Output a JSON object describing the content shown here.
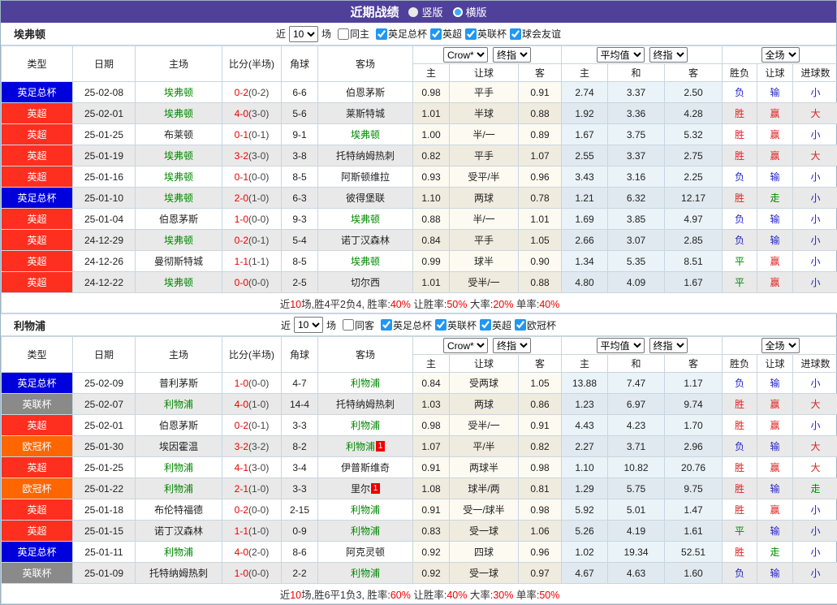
{
  "title": "近期战绩",
  "view_modes": {
    "vertical": "竖版",
    "horizontal": "横版"
  },
  "league_colors": {
    "英足总杯": "#0000dd",
    "英超": "#ff2f1f",
    "英联杯": "#8a8a8a",
    "欧冠杯": "#ff6600",
    "球会友谊": "#8a8a8a"
  },
  "result_colors": {
    "胜": "#dd2222",
    "赢": "#dd2222",
    "大": "#dd2222",
    "负": "#2222cc",
    "输": "#2222cc",
    "小": "#2222cc",
    "平": "#008800",
    "走": "#008800"
  },
  "columns": {
    "type": "类型",
    "date": "日期",
    "home": "主场",
    "score": "比分(半场)",
    "corner": "角球",
    "away": "客场",
    "h": "主",
    "handicap": "让球",
    "a": "客",
    "avg_h": "主",
    "avg_d": "和",
    "avg_a": "客",
    "wdl": "胜负",
    "asian": "让球",
    "goals": "进球数"
  },
  "selectors": {
    "bookmaker": "Crow*",
    "final1": "终指",
    "average": "平均值",
    "final2": "终指",
    "scope": "全场"
  },
  "filter_labels": {
    "recent": "近",
    "matches": "场",
    "count": "10"
  },
  "sections": [
    {
      "team": "埃弗顿",
      "same_venue_label": "同主",
      "leagues": [
        "英足总杯",
        "英超",
        "英联杯",
        "球会友谊"
      ],
      "rows": [
        {
          "lg": "英足总杯",
          "date": "25-02-08",
          "home": "埃弗顿",
          "home_self": true,
          "ft": "0-2",
          "ht": "0-2",
          "corner": "6-6",
          "away": "伯恩茅斯",
          "away_self": false,
          "away_cards": 0,
          "bk": [
            "0.98",
            "平手",
            "0.91"
          ],
          "avg": [
            "2.74",
            "3.37",
            "2.50"
          ],
          "res": [
            "负",
            "输",
            "小"
          ]
        },
        {
          "lg": "英超",
          "date": "25-02-01",
          "home": "埃弗顿",
          "home_self": true,
          "ft": "4-0",
          "ht": "3-0",
          "corner": "5-6",
          "away": "莱斯特城",
          "away_self": false,
          "away_cards": 0,
          "bk": [
            "1.01",
            "半球",
            "0.88"
          ],
          "avg": [
            "1.92",
            "3.36",
            "4.28"
          ],
          "res": [
            "胜",
            "赢",
            "大"
          ]
        },
        {
          "lg": "英超",
          "date": "25-01-25",
          "home": "布莱顿",
          "home_self": false,
          "ft": "0-1",
          "ht": "0-1",
          "corner": "9-1",
          "away": "埃弗顿",
          "away_self": true,
          "away_cards": 0,
          "bk": [
            "1.00",
            "半/一",
            "0.89"
          ],
          "avg": [
            "1.67",
            "3.75",
            "5.32"
          ],
          "res": [
            "胜",
            "赢",
            "小"
          ]
        },
        {
          "lg": "英超",
          "date": "25-01-19",
          "home": "埃弗顿",
          "home_self": true,
          "ft": "3-2",
          "ht": "3-0",
          "corner": "3-8",
          "away": "托特纳姆热刺",
          "away_self": false,
          "away_cards": 0,
          "bk": [
            "0.82",
            "平手",
            "1.07"
          ],
          "avg": [
            "2.55",
            "3.37",
            "2.75"
          ],
          "res": [
            "胜",
            "赢",
            "大"
          ]
        },
        {
          "lg": "英超",
          "date": "25-01-16",
          "home": "埃弗顿",
          "home_self": true,
          "ft": "0-1",
          "ht": "0-0",
          "corner": "8-5",
          "away": "阿斯顿维拉",
          "away_self": false,
          "away_cards": 0,
          "bk": [
            "0.93",
            "受平/半",
            "0.96"
          ],
          "avg": [
            "3.43",
            "3.16",
            "2.25"
          ],
          "res": [
            "负",
            "输",
            "小"
          ]
        },
        {
          "lg": "英足总杯",
          "date": "25-01-10",
          "home": "埃弗顿",
          "home_self": true,
          "ft": "2-0",
          "ht": "1-0",
          "corner": "6-3",
          "away": "彼得堡联",
          "away_self": false,
          "away_cards": 0,
          "bk": [
            "1.10",
            "两球",
            "0.78"
          ],
          "avg": [
            "1.21",
            "6.32",
            "12.17"
          ],
          "res": [
            "胜",
            "走",
            "小"
          ]
        },
        {
          "lg": "英超",
          "date": "25-01-04",
          "home": "伯恩茅斯",
          "home_self": false,
          "ft": "1-0",
          "ht": "0-0",
          "corner": "9-3",
          "away": "埃弗顿",
          "away_self": true,
          "away_cards": 0,
          "bk": [
            "0.88",
            "半/一",
            "1.01"
          ],
          "avg": [
            "1.69",
            "3.85",
            "4.97"
          ],
          "res": [
            "负",
            "输",
            "小"
          ]
        },
        {
          "lg": "英超",
          "date": "24-12-29",
          "home": "埃弗顿",
          "home_self": true,
          "ft": "0-2",
          "ht": "0-1",
          "corner": "5-4",
          "away": "诺丁汉森林",
          "away_self": false,
          "away_cards": 0,
          "bk": [
            "0.84",
            "平手",
            "1.05"
          ],
          "avg": [
            "2.66",
            "3.07",
            "2.85"
          ],
          "res": [
            "负",
            "输",
            "小"
          ]
        },
        {
          "lg": "英超",
          "date": "24-12-26",
          "home": "曼彻斯特城",
          "home_self": false,
          "ft": "1-1",
          "ht": "1-1",
          "corner": "8-5",
          "away": "埃弗顿",
          "away_self": true,
          "away_cards": 0,
          "bk": [
            "0.99",
            "球半",
            "0.90"
          ],
          "avg": [
            "1.34",
            "5.35",
            "8.51"
          ],
          "res": [
            "平",
            "赢",
            "小"
          ]
        },
        {
          "lg": "英超",
          "date": "24-12-22",
          "home": "埃弗顿",
          "home_self": true,
          "ft": "0-0",
          "ht": "0-0",
          "corner": "2-5",
          "away": "切尔西",
          "away_self": false,
          "away_cards": 0,
          "bk": [
            "1.01",
            "受半/一",
            "0.88"
          ],
          "avg": [
            "4.80",
            "4.09",
            "1.67"
          ],
          "res": [
            "平",
            "赢",
            "小"
          ]
        }
      ],
      "summary": [
        [
          "近",
          0
        ],
        [
          "10",
          1
        ],
        [
          "场,胜4平2负4, 胜率:",
          0
        ],
        [
          "40%",
          1
        ],
        [
          " 让胜率:",
          0
        ],
        [
          "50%",
          1
        ],
        [
          " 大率:",
          0
        ],
        [
          "20%",
          1
        ],
        [
          " 单率:",
          0
        ],
        [
          "40%",
          1
        ]
      ]
    },
    {
      "team": "利物浦",
      "same_venue_label": "同客",
      "leagues": [
        "英足总杯",
        "英联杯",
        "英超",
        "欧冠杯"
      ],
      "rows": [
        {
          "lg": "英足总杯",
          "date": "25-02-09",
          "home": "普利茅斯",
          "home_self": false,
          "ft": "1-0",
          "ht": "0-0",
          "corner": "4-7",
          "away": "利物浦",
          "away_self": true,
          "away_cards": 0,
          "bk": [
            "0.84",
            "受两球",
            "1.05"
          ],
          "avg": [
            "13.88",
            "7.47",
            "1.17"
          ],
          "res": [
            "负",
            "输",
            "小"
          ]
        },
        {
          "lg": "英联杯",
          "date": "25-02-07",
          "home": "利物浦",
          "home_self": true,
          "ft": "4-0",
          "ht": "1-0",
          "corner": "14-4",
          "away": "托特纳姆热刺",
          "away_self": false,
          "away_cards": 0,
          "bk": [
            "1.03",
            "两球",
            "0.86"
          ],
          "avg": [
            "1.23",
            "6.97",
            "9.74"
          ],
          "res": [
            "胜",
            "赢",
            "大"
          ]
        },
        {
          "lg": "英超",
          "date": "25-02-01",
          "home": "伯恩茅斯",
          "home_self": false,
          "ft": "0-2",
          "ht": "0-1",
          "corner": "3-3",
          "away": "利物浦",
          "away_self": true,
          "away_cards": 0,
          "bk": [
            "0.98",
            "受半/一",
            "0.91"
          ],
          "avg": [
            "4.43",
            "4.23",
            "1.70"
          ],
          "res": [
            "胜",
            "赢",
            "小"
          ]
        },
        {
          "lg": "欧冠杯",
          "date": "25-01-30",
          "home": "埃因霍温",
          "home_self": false,
          "ft": "3-2",
          "ht": "3-2",
          "corner": "8-2",
          "away": "利物浦",
          "away_self": true,
          "away_cards": 1,
          "bk": [
            "1.07",
            "平/半",
            "0.82"
          ],
          "avg": [
            "2.27",
            "3.71",
            "2.96"
          ],
          "res": [
            "负",
            "输",
            "大"
          ]
        },
        {
          "lg": "英超",
          "date": "25-01-25",
          "home": "利物浦",
          "home_self": true,
          "ft": "4-1",
          "ht": "3-0",
          "corner": "3-4",
          "away": "伊普斯维奇",
          "away_self": false,
          "away_cards": 0,
          "bk": [
            "0.91",
            "两球半",
            "0.98"
          ],
          "avg": [
            "1.10",
            "10.82",
            "20.76"
          ],
          "res": [
            "胜",
            "赢",
            "大"
          ]
        },
        {
          "lg": "欧冠杯",
          "date": "25-01-22",
          "home": "利物浦",
          "home_self": true,
          "ft": "2-1",
          "ht": "1-0",
          "corner": "3-3",
          "away": "里尔",
          "away_self": false,
          "away_cards": 1,
          "bk": [
            "1.08",
            "球半/两",
            "0.81"
          ],
          "avg": [
            "1.29",
            "5.75",
            "9.75"
          ],
          "res": [
            "胜",
            "输",
            "走"
          ]
        },
        {
          "lg": "英超",
          "date": "25-01-18",
          "home": "布伦特福德",
          "home_self": false,
          "ft": "0-2",
          "ht": "0-0",
          "corner": "2-15",
          "away": "利物浦",
          "away_self": true,
          "away_cards": 0,
          "bk": [
            "0.91",
            "受一/球半",
            "0.98"
          ],
          "avg": [
            "5.92",
            "5.01",
            "1.47"
          ],
          "res": [
            "胜",
            "赢",
            "小"
          ]
        },
        {
          "lg": "英超",
          "date": "25-01-15",
          "home": "诺丁汉森林",
          "home_self": false,
          "ft": "1-1",
          "ht": "1-0",
          "corner": "0-9",
          "away": "利物浦",
          "away_self": true,
          "away_cards": 0,
          "bk": [
            "0.83",
            "受一球",
            "1.06"
          ],
          "avg": [
            "5.26",
            "4.19",
            "1.61"
          ],
          "res": [
            "平",
            "输",
            "小"
          ]
        },
        {
          "lg": "英足总杯",
          "date": "25-01-11",
          "home": "利物浦",
          "home_self": true,
          "ft": "4-0",
          "ht": "2-0",
          "corner": "8-6",
          "away": "阿克灵顿",
          "away_self": false,
          "away_cards": 0,
          "bk": [
            "0.92",
            "四球",
            "0.96"
          ],
          "avg": [
            "1.02",
            "19.34",
            "52.51"
          ],
          "res": [
            "胜",
            "走",
            "小"
          ]
        },
        {
          "lg": "英联杯",
          "date": "25-01-09",
          "home": "托特纳姆热刺",
          "home_self": false,
          "ft": "1-0",
          "ht": "0-0",
          "corner": "2-2",
          "away": "利物浦",
          "away_self": true,
          "away_cards": 0,
          "bk": [
            "0.92",
            "受一球",
            "0.97"
          ],
          "avg": [
            "4.67",
            "4.63",
            "1.60"
          ],
          "res": [
            "负",
            "输",
            "小"
          ]
        }
      ],
      "summary": [
        [
          "近",
          0
        ],
        [
          "10",
          1
        ],
        [
          "场,胜6平1负3, 胜率:",
          0
        ],
        [
          "60%",
          1
        ],
        [
          " 让胜率:",
          0
        ],
        [
          "40%",
          1
        ],
        [
          " 大率:",
          0
        ],
        [
          "30%",
          1
        ],
        [
          " 单率:",
          0
        ],
        [
          "50%",
          1
        ]
      ]
    }
  ]
}
